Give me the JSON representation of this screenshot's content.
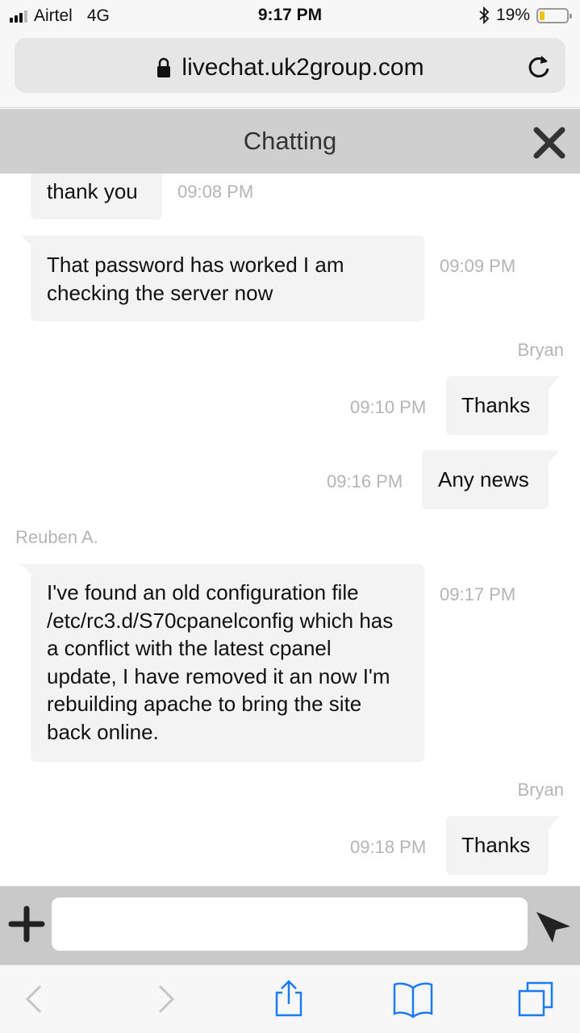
{
  "status_bar": {
    "carrier": "Airtel",
    "network": "4G",
    "time": "9:17 PM",
    "battery": "19%",
    "battery_level": 0.19,
    "icons": [
      "signal-icon",
      "bluetooth-icon",
      "battery-icon"
    ]
  },
  "browser": {
    "url": "livechat.uk2group.com",
    "icons": [
      "lock-icon",
      "reload-icon"
    ]
  },
  "chat_header": {
    "title": "Chatting"
  },
  "messages": [
    {
      "direction": "in",
      "text": "thank you",
      "time": "09:08 PM"
    },
    {
      "direction": "in",
      "text": "That password has worked I am checking the server now",
      "time": "09:09 PM"
    },
    {
      "direction": "out",
      "sender": "Bryan",
      "text": "Thanks",
      "time": "09:10 PM"
    },
    {
      "direction": "out",
      "text": "Any news",
      "time": "09:16 PM"
    },
    {
      "direction": "in",
      "sender": "Reuben A.",
      "text": "I've found an old configuration file /etc/rc3.d/S70cpanelconfig which has a conflict with the latest cpanel update, I have removed it an now I'm rebuilding apache to bring the site back online.",
      "time": "09:17 PM"
    },
    {
      "direction": "out",
      "sender": "Bryan",
      "text": "Thanks",
      "time": "09:18 PM"
    }
  ],
  "input_bar": {
    "value": "",
    "placeholder": ""
  },
  "colors": {
    "header_bg": "#cfcfcf",
    "bubble_bg": "#f3f3f3",
    "timestamp": "#b5b5b5",
    "safari_blue": "#1a7cf5",
    "battery_fill": "#f2c40f"
  }
}
